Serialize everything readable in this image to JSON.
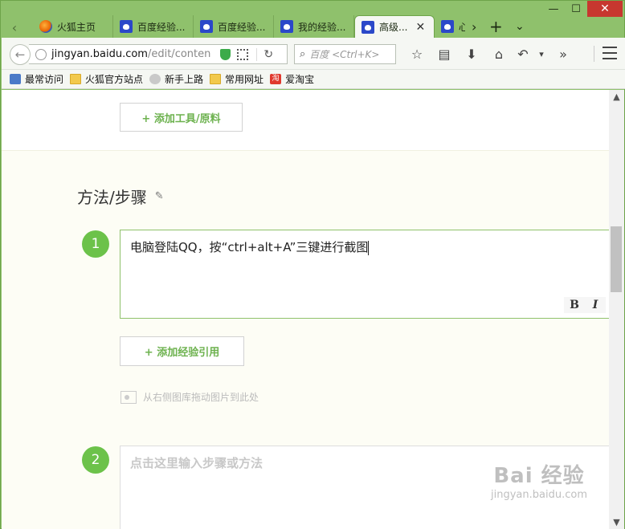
{
  "window": {
    "controls": [
      "—",
      "☐",
      "✕"
    ]
  },
  "tabs": [
    {
      "label": "火狐主页",
      "icon": "firefox-icon"
    },
    {
      "label": "百度经验...",
      "icon": "baidu-paw-icon"
    },
    {
      "label": "百度经验...",
      "icon": "baidu-paw-icon"
    },
    {
      "label": "我的经验...",
      "icon": "baidu-paw-icon"
    },
    {
      "label": "高级...",
      "icon": "baidu-paw-icon",
      "active": true
    },
    {
      "label": "心",
      "icon": "baidu-paw-icon"
    }
  ],
  "tab_strip": {
    "scroll_left": "‹",
    "scroll_right": "›",
    "new_tab": "+",
    "list_all": "⌄",
    "close_tab": "✕"
  },
  "navbar": {
    "back": "←",
    "url_host": "jingyan.baidu.com",
    "url_path": "/edit/conten",
    "reload": "↻",
    "search_placeholder": "百度 <Ctrl+K>",
    "search_icon": "⌕",
    "icons": [
      "☆",
      "▤",
      "⬇",
      "⌂",
      "↶",
      "▾",
      "»"
    ]
  },
  "bookmarks": [
    {
      "label": "最常访问",
      "icon": "star"
    },
    {
      "label": "火狐官方站点",
      "icon": "folder"
    },
    {
      "label": "新手上路",
      "icon": "globe2"
    },
    {
      "label": "常用网址",
      "icon": "folder"
    },
    {
      "label": "爱淘宝",
      "icon": "taobao",
      "glyph": "淘"
    }
  ],
  "page": {
    "add_tools_button": "+ 添加工具/原料",
    "section_title": "方法/步骤",
    "section_edit_icon": "✎",
    "steps": [
      {
        "number": "1",
        "text": "电脑登陆QQ，按“ctrl+alt+A”三键进行截图"
      },
      {
        "number": "2",
        "placeholder": "点击这里输入步骤或方法"
      }
    ],
    "format_bold": "B",
    "format_italic": "I",
    "add_reference_button": "+ 添加经验引用",
    "drop_hint": "从右侧图库拖动图片到此处"
  },
  "watermark": {
    "line1": "Bai 经验",
    "line2": "jingyan.baidu.com"
  },
  "colors": {
    "frame": "#8fc16c",
    "accent_green": "#6cc24a",
    "close_red": "#c7372f",
    "baidu_blue": "#2b48c9"
  }
}
